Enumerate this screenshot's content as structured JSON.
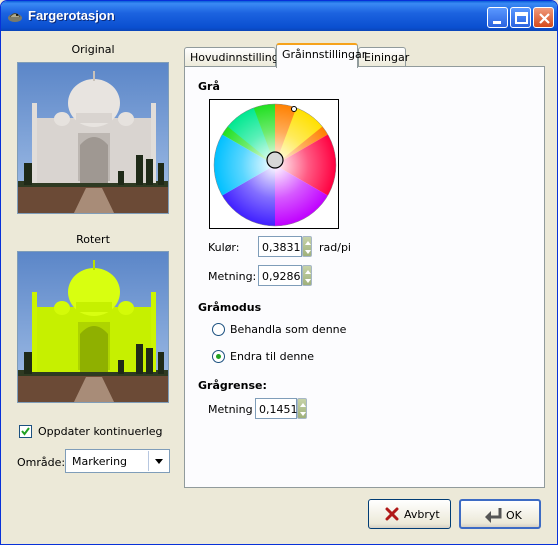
{
  "window": {
    "title": "Fargerotasjon"
  },
  "left": {
    "original_label": "Original",
    "rotated_label": "Rotert",
    "update_checkbox": {
      "label": "Oppdater kontinuerleg",
      "checked": true
    },
    "area": {
      "label": "Område:",
      "value": "Markering"
    }
  },
  "tabs": [
    {
      "label": "Hovudinnstillingar",
      "active": false
    },
    {
      "label": "Gråinnstillingar",
      "active": true
    },
    {
      "label": "Einingar",
      "active": false
    }
  ],
  "gray": {
    "heading": "Grå",
    "hue": {
      "label": "Kulør:",
      "value": "0,3831",
      "unit": "rad/pi"
    },
    "saturation": {
      "label": "Metning:",
      "value": "0,9286"
    }
  },
  "graymode": {
    "heading": "Gråmodus",
    "options": [
      {
        "label": "Behandla som denne",
        "selected": false
      },
      {
        "label": "Endra til denne",
        "selected": true
      }
    ]
  },
  "threshold": {
    "heading": "Grågrense:",
    "label": "Metning",
    "value": "0,1451"
  },
  "buttons": {
    "cancel": "Avbryt",
    "ok": "OK"
  },
  "colors": {
    "titlebar": "#0a4fd0",
    "face": "#ece9d8",
    "tab_accent": "#f6a21b",
    "highlight_green": "#c8ff00"
  }
}
